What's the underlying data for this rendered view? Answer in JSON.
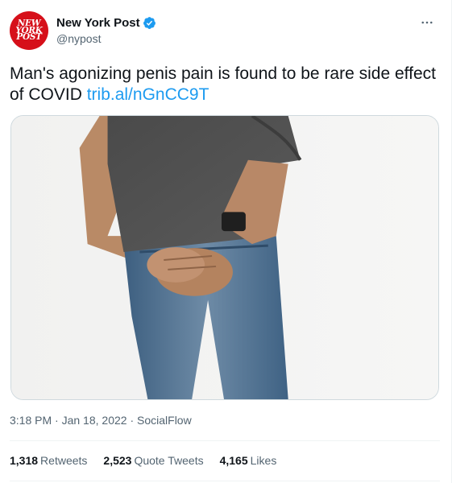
{
  "account": {
    "avatar_text": [
      "NEW",
      "YORK",
      "POST"
    ],
    "display_name": "New York Post",
    "handle": "@nypost",
    "verified": true,
    "verified_color": "#1d9bf0",
    "avatar_color": "#d6101a"
  },
  "more_icon": "more-horizontal-icon",
  "tweet": {
    "text": "Man's agonizing penis pain is found to be rare side effect of COVID ",
    "link_text": "trib.al/nGnCC9T",
    "link_color": "#1d9bf0"
  },
  "media": {
    "icon": "photo",
    "subject": "man in grey t-shirt and blue jeans holding groin"
  },
  "meta": {
    "time": "3:18 PM",
    "date": "Jan 18, 2022",
    "source": "SocialFlow",
    "separator": " · "
  },
  "stats": [
    {
      "count": "1,318",
      "label": "Retweets"
    },
    {
      "count": "2,523",
      "label": "Quote Tweets"
    },
    {
      "count": "4,165",
      "label": "Likes"
    }
  ]
}
